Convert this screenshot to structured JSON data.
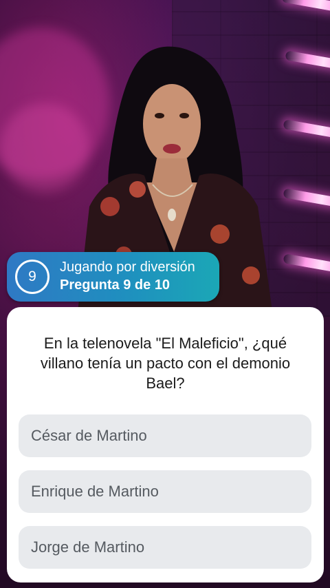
{
  "status": {
    "question_number": "9",
    "mode_label": "Jugando por diversión",
    "progress_label": "Pregunta 9 de 10"
  },
  "question": {
    "text": "En la telenovela \"El Maleficio\", ¿qué villano tenía un pacto con el demonio Bael?"
  },
  "answers": [
    {
      "label": "César de Martino"
    },
    {
      "label": "Enrique de Martino"
    },
    {
      "label": "Jorge de Martino"
    }
  ],
  "colors": {
    "pill_start": "#2f79c4",
    "pill_end": "#1ba7b6",
    "card_bg": "#ffffff",
    "answer_bg": "#e8eaed",
    "answer_text": "#555a60"
  },
  "icons": {
    "question_number_badge": "circle-ring-number"
  }
}
